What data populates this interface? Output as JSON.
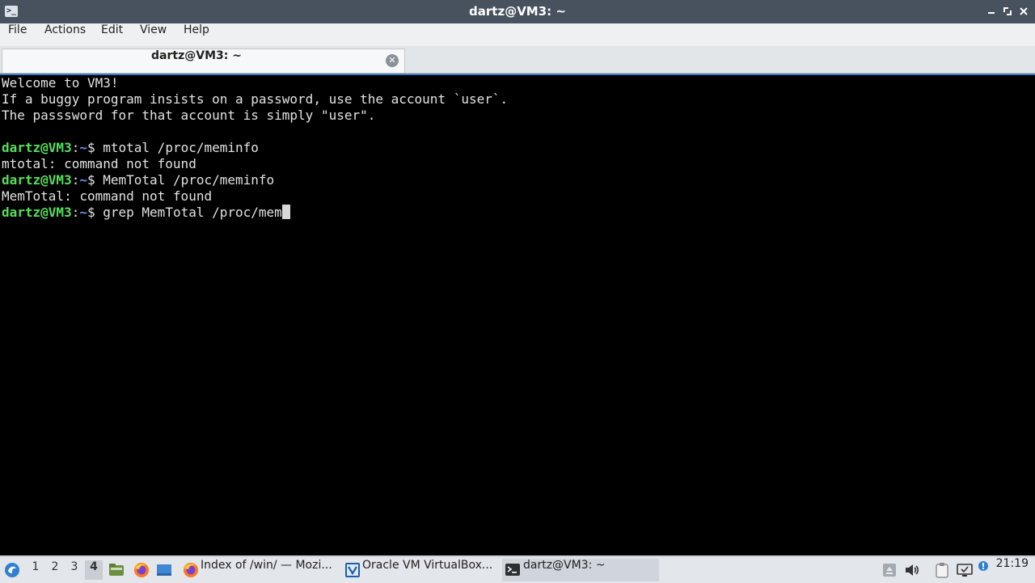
{
  "window": {
    "title": "dartz@VM3: ~",
    "icon": "terminal-icon",
    "controls": [
      "minimize-icon",
      "maximize-icon",
      "close-icon"
    ]
  },
  "menu": {
    "items": [
      "File",
      "Actions",
      "Edit",
      "View",
      "Help"
    ]
  },
  "tab": {
    "label": "dartz@VM3: ~",
    "close_icon": "close-circle-icon"
  },
  "terminal": {
    "colors": {
      "background": "#000000",
      "text": "#e2e2e2",
      "user": "#54e05a",
      "path": "#6d8fe0"
    },
    "motd": [
      "Welcome to VM3!",
      "If a buggy program insists on a password, use the account `user`.",
      "The passsword for that account is simply \"user\"."
    ],
    "prompt": {
      "user": "dartz@VM3",
      "sep": ":",
      "path": "~",
      "symbol": "$ "
    },
    "history": [
      {
        "command": "mtotal /proc/meminfo",
        "output": "mtotal: command not found"
      },
      {
        "command": "MemTotal /proc/meminfo",
        "output": "MemTotal: command not found"
      }
    ],
    "current_input": "grep MemTotal /proc/mem"
  },
  "taskbar": {
    "start_icon": "start-menu-icon",
    "workspaces": [
      "1",
      "2",
      "3",
      "4"
    ],
    "active_workspace": "4",
    "launchers": [
      "file-manager-icon",
      "firefox-icon",
      "desktop-icon"
    ],
    "tasks": [
      {
        "label": "Index of /win/ — Mozi...",
        "icon": "firefox-icon"
      },
      {
        "label": "Oracle VM VirtualBox...",
        "icon": "virtualbox-icon"
      },
      {
        "label": "dartz@VM3: ~",
        "icon": "terminal-icon"
      }
    ],
    "tray": [
      "drive-icon",
      "volume-icon",
      "clipboard-icon",
      "monitor-icon",
      "notification-icon"
    ],
    "clock": "21:19"
  }
}
